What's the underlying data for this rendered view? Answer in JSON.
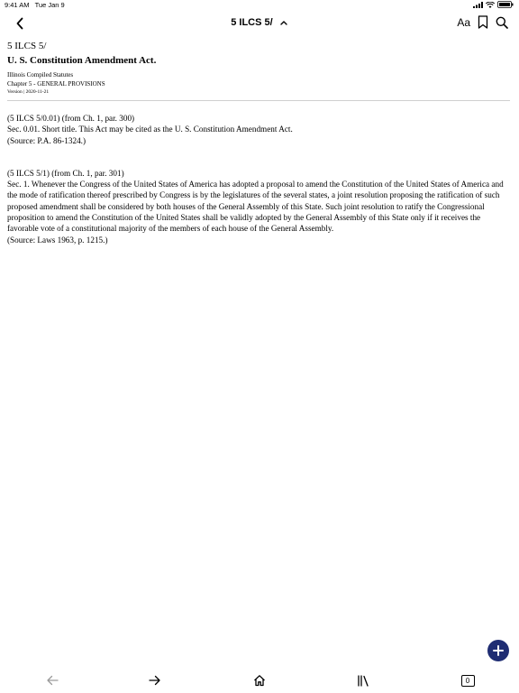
{
  "status": {
    "time": "9:41 AM",
    "date": "Tue Jan 9"
  },
  "nav": {
    "title": "5 ILCS 5/",
    "font_button": "Aa"
  },
  "doc": {
    "citation": "5 ILCS 5/",
    "title": "U. S. Constitution Amendment Act.",
    "source": "Illinois Compiled Statutes",
    "chapter": "Chapter 5 - GENERAL PROVISIONS",
    "version": "Version | 2020-11-21",
    "sections": [
      {
        "ref": "(5 ILCS 5/0.01) (from Ch. 1, par. 300)",
        "text": "Sec. 0.01. Short title. This Act may be cited as the U. S. Constitution Amendment Act.",
        "note": "(Source: P.A. 86-1324.)"
      },
      {
        "ref": "(5 ILCS 5/1) (from Ch. 1, par. 301)",
        "text": "Sec. 1. Whenever the Congress of the United States of America has adopted a proposal to amend the Constitution of the United States of America and the mode of ratification thereof prescribed by Congress is by the legislatures of the several states, a joint resolution proposing the ratification of such proposed amendment shall be considered by both houses of the General Assembly of this State. Such joint resolution to ratify the Congressional proposition to amend the Constitution of the United States shall be validly adopted by the General Assembly of this State only if it receives the favorable vote of a constitutional majority of the members of each house of the General Assembly.",
        "note": "(Source: Laws 1963, p. 1215.)"
      }
    ]
  },
  "toolbar": {
    "tabs_count": "0"
  },
  "colors": {
    "fab": "#1f2d73"
  }
}
